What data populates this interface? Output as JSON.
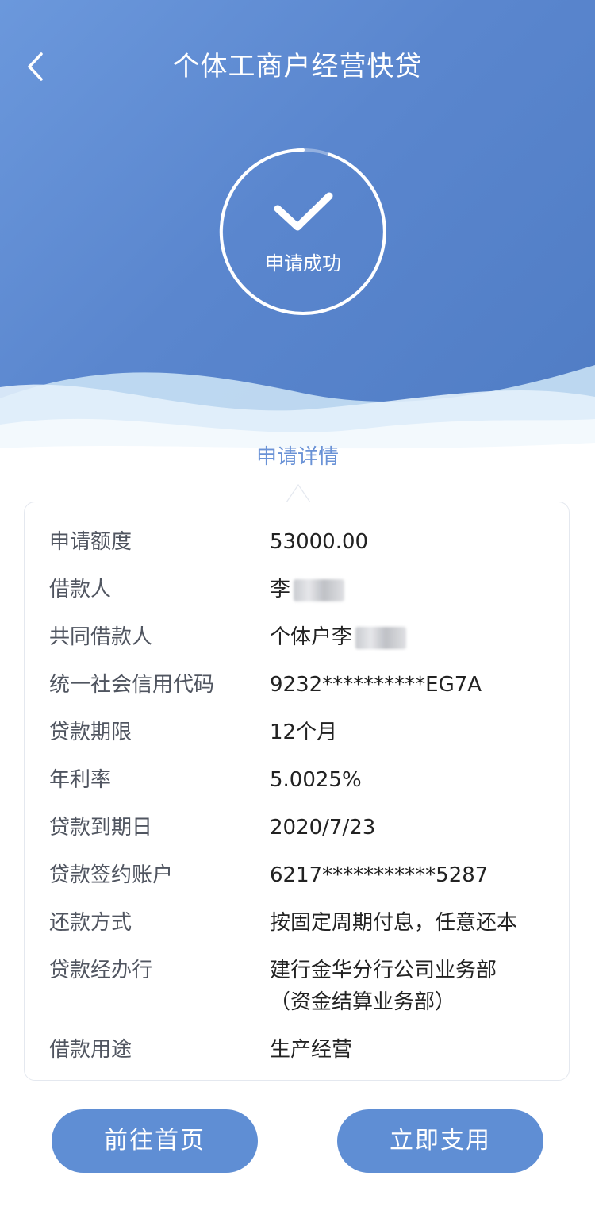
{
  "header": {
    "title": "个体工商户经营快贷"
  },
  "status": {
    "text": "申请成功",
    "icon": "check-icon"
  },
  "details": {
    "section_title": "申请详情",
    "rows": [
      {
        "label": "申请额度",
        "value": "53000.00"
      },
      {
        "label": "借款人",
        "value": "李"
      },
      {
        "label": "共同借款人",
        "value": "个体户李"
      },
      {
        "label": "统一社会信用代码",
        "value": "9232**********EG7A"
      },
      {
        "label": "贷款期限",
        "value": "12个月"
      },
      {
        "label": "年利率",
        "value": "5.0025%"
      },
      {
        "label": "贷款到期日",
        "value": "2020/7/23"
      },
      {
        "label": "贷款签约账户",
        "value": "6217***********5287"
      },
      {
        "label": "还款方式",
        "value": "按固定周期付息，任意还本"
      },
      {
        "label": "贷款经办行",
        "value": "建行金华分行公司业务部",
        "value2": "（资金结算业务部）"
      },
      {
        "label": "借款用途",
        "value": "生产经营"
      }
    ]
  },
  "actions": {
    "home_label": "前往首页",
    "use_label": "立即支用"
  },
  "colors": {
    "primary": "#5f8ed4",
    "accent_text": "#6a92d6"
  }
}
